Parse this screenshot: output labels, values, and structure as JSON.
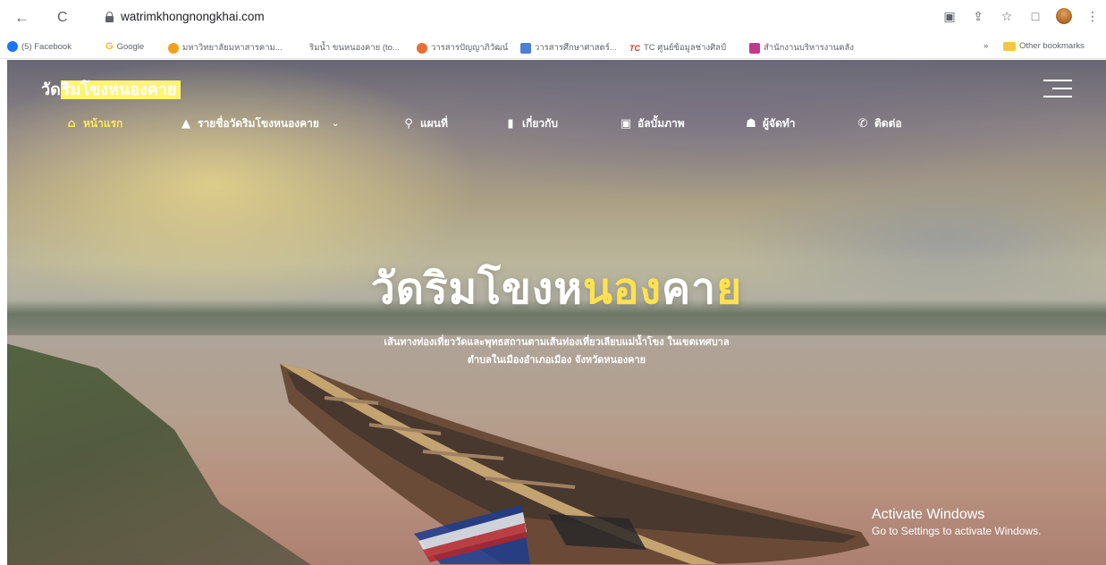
{
  "browser": {
    "url": "watrimkhongnongkhai.com",
    "back_icon": "←",
    "reload_icon": "C",
    "right_icons": [
      "translate-icon",
      "share-icon",
      "star-icon",
      "side-panel-icon",
      "profile-icon",
      "menu-icon"
    ],
    "menu_glyph": "⋮"
  },
  "bookmarks": [
    {
      "label": "(5) Facebook",
      "color": "#1877f2"
    },
    {
      "label": "Google",
      "color": "#fbbc05"
    },
    {
      "label": "มหาวิทยาลัยมหาสารคาม...",
      "color": "#f3a11c"
    },
    {
      "label": "ริมน้ำ ขนหนองคาย (to...",
      "color": "#e9e9e9"
    },
    {
      "label": "วารสารปัญญาภิวัฒน์",
      "color": "#e86f36"
    },
    {
      "label": "วารสารศึกษาศาสตร์...",
      "color": "#4a7fd6"
    },
    {
      "label": "TC ศูนย์ข้อมูลช่างศิลป์",
      "color": "#d63a2a"
    },
    {
      "label": "สำนักงานบริหารงานคลัง",
      "color": "#c8378f"
    }
  ],
  "bookmarks_overflow": "»",
  "other_bookmarks": "Other bookmarks",
  "site": {
    "logo_prefix": "วัด",
    "logo_highlight": "ริมโขงหนองคาย",
    "menu": [
      {
        "label": "หน้าแรก",
        "icon": "home-icon",
        "glyph": "🏠",
        "active": true
      },
      {
        "label": "รายชื่อวัดริมโขงหนองคาย",
        "icon": "temple-icon",
        "glyph": "⛰",
        "dropdown": "⌄"
      },
      {
        "label": "แผนที่",
        "icon": "map-marker-icon",
        "glyph": "📍"
      },
      {
        "label": "เกี่ยวกับ",
        "icon": "book-icon",
        "glyph": "📘"
      },
      {
        "label": "อัลบั้มภาพ",
        "icon": "photo-album-icon",
        "glyph": "🖼"
      },
      {
        "label": "ผู้จัดทำ",
        "icon": "people-icon",
        "glyph": "👥"
      },
      {
        "label": "ติดต่อ",
        "icon": "phone-icon",
        "glyph": "📞"
      }
    ],
    "hero_title_part1": "วัด",
    "hero_title_part2": "ริมโขงห",
    "hero_title_part3": "นอง",
    "hero_title_part4": "คา",
    "hero_title_part5": "ย",
    "hero_sub_line1": "เส้นทางท่องเที่ยววัดและพุทธสถานตามเส้นท่องเที่ยวเลียบแม่น้ำโขง ในเขตเทศบาล",
    "hero_sub_line2": "ตำบลในเมืองอำเภอเมือง จังหวัดหนองคาย"
  },
  "windows_activation": {
    "title": "Activate Windows",
    "subtitle": "Go to Settings to activate Windows."
  }
}
